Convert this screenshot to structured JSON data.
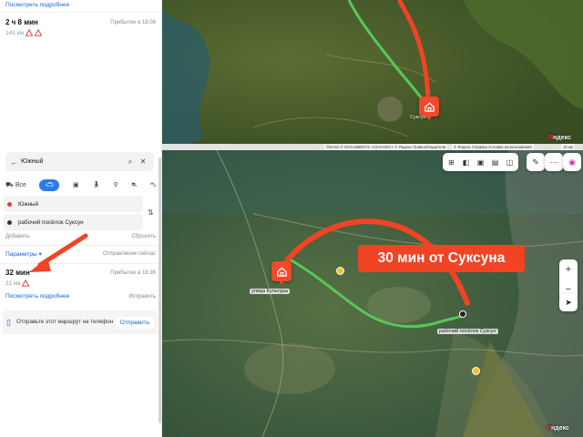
{
  "top_panel": {
    "details_link": "Посмотреть подробнее",
    "route_time": "2 ч 8 мин",
    "arrival": "Прибытие в 18:08",
    "distance": "141 км"
  },
  "search": {
    "back_icon": "arrow-left-icon",
    "value": "Южный",
    "search_icon": "search-icon",
    "close_icon": "close-icon"
  },
  "modes": {
    "all_label": "Все",
    "items": [
      "car-icon",
      "bus-icon",
      "walk-icon",
      "bike-icon",
      "scooter-icon",
      "taxi-icon"
    ]
  },
  "route_points": {
    "from": "Южный",
    "to": "рабочий посёлок Суксун",
    "from_color": "#e53935",
    "to_color": "#333333"
  },
  "actions": {
    "add": "Добавить",
    "reset": "Сбросить",
    "params": "Параметры",
    "departure": "Отправление сейчас"
  },
  "route": {
    "time": "32 мин",
    "arrival": "Прибытие в 16:36",
    "distance": "31 км",
    "details_link": "Посмотреть подробнее",
    "edit": "Исправить"
  },
  "share": {
    "message": "Отправьте этот маршрут на телефон",
    "button": "Отправить"
  },
  "top_map": {
    "label_town": "улица Культуры",
    "label_pin": "Суксун",
    "attribution": "©NASA © DOCUMENTS «СКАНЭКС» © Яндекс Правообладатели",
    "attribution_right": "© Яндекс Справка Условия использования",
    "scale": "10 км",
    "brand": "Яндекс"
  },
  "bottom_map": {
    "banner": "30 мин от Суксуна",
    "start_label": "улица Культуры",
    "end_label": "рабочий посёлок Суксун",
    "brand": "Яндекс",
    "route_color": "#57c85a",
    "arc_color": "#f04424"
  }
}
